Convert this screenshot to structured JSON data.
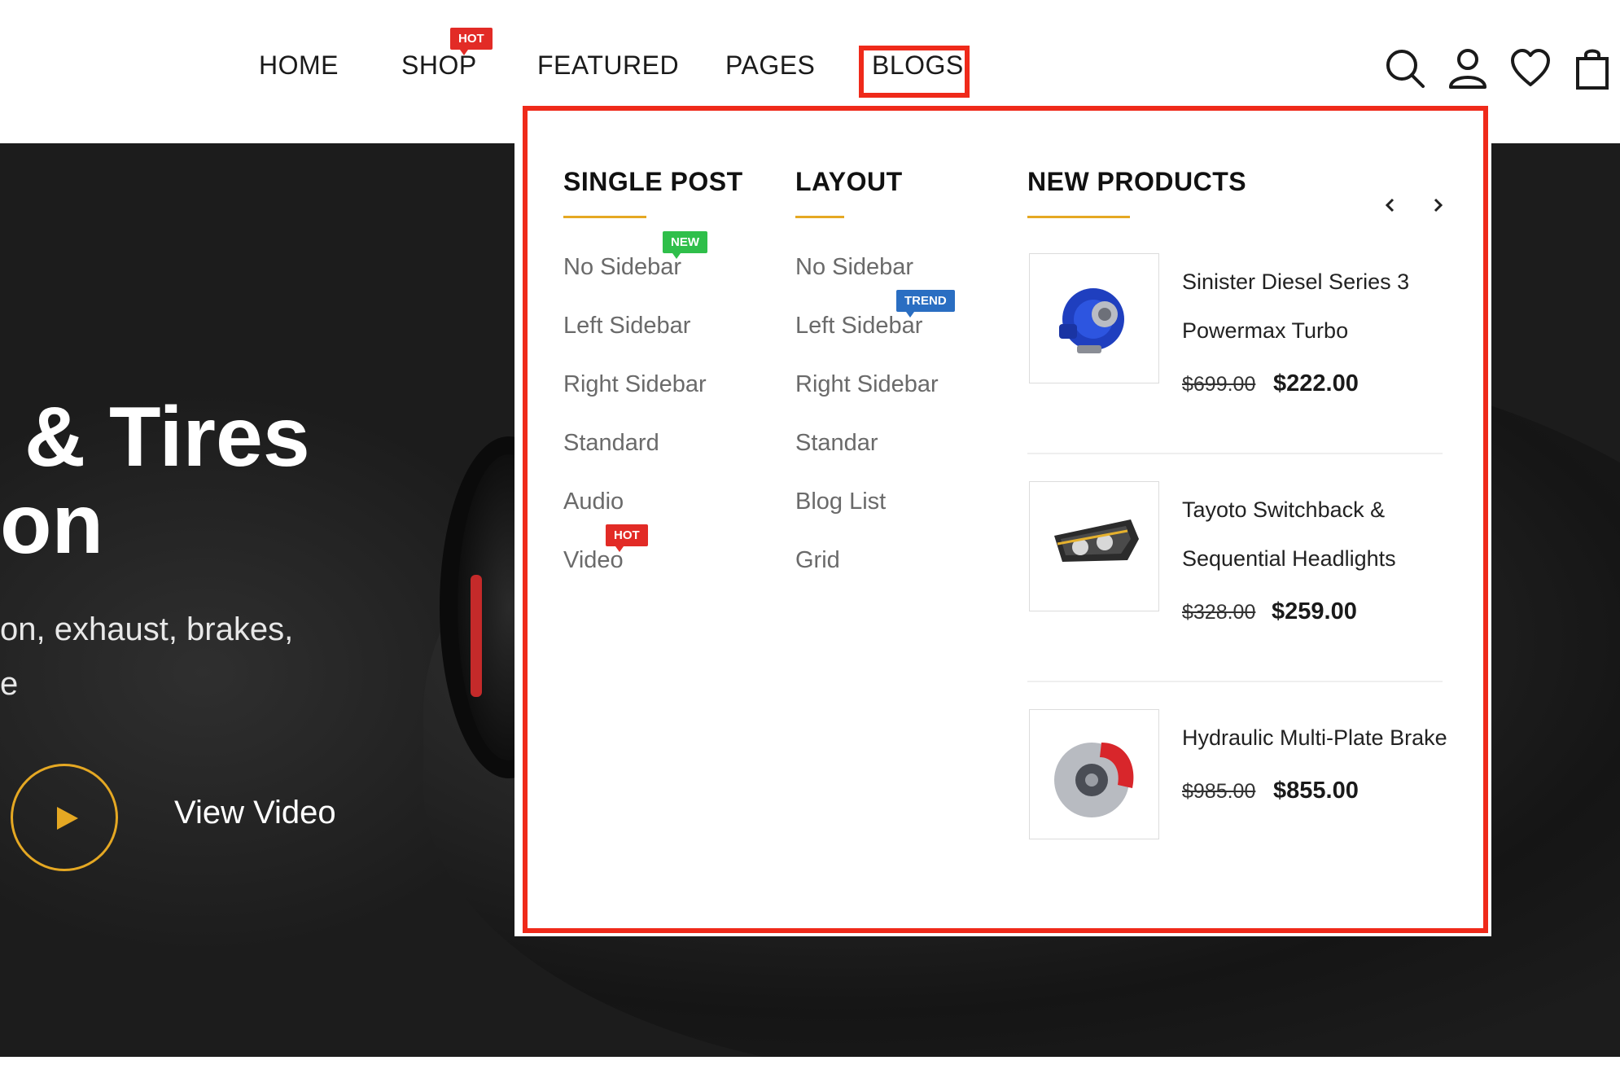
{
  "nav": {
    "items": [
      "HOME",
      "SHOP",
      "FEATURED",
      "PAGES",
      "BLOGS"
    ],
    "shop_badge": "HOT",
    "active_item": "BLOGS"
  },
  "header_icons": [
    "search-icon",
    "user-icon",
    "heart-icon",
    "shopping-bag-icon"
  ],
  "hero": {
    "title_line1": "& Tires",
    "title_line2": "on",
    "subtitle_line1": "on, exhaust, brakes,",
    "subtitle_line2": "e",
    "video_label": "View Video"
  },
  "mega_menu": {
    "single_post": {
      "heading": "SINGLE POST",
      "links": [
        "No Sidebar",
        "Left Sidebar",
        "Right Sidebar",
        "Standard",
        "Audio",
        "Video"
      ],
      "badge_new": "NEW",
      "badge_hot": "HOT"
    },
    "layout": {
      "heading": "LAYOUT",
      "links": [
        "No Sidebar",
        "Left Sidebar",
        "Right Sidebar",
        "Standar",
        "Blog List",
        "Grid"
      ],
      "badge_trend": "TREND"
    },
    "new_products": {
      "heading": "NEW PRODUCTS",
      "products": [
        {
          "name": "Sinister Diesel Series 3 Powermax Turbo",
          "old_price": "$699.00",
          "price": "$222.00"
        },
        {
          "name": "Tayoto Switchback & Sequential Headlights",
          "old_price": "$328.00",
          "price": "$259.00"
        },
        {
          "name": "Hydraulic Multi-Plate Brake",
          "old_price": "$985.00",
          "price": "$855.00"
        }
      ]
    }
  },
  "colors": {
    "accent": "#e5a823",
    "highlight": "#ef2a1a",
    "badge_hot": "#e22b26",
    "badge_new": "#2fbf4a",
    "badge_trend": "#2a6ec2"
  }
}
